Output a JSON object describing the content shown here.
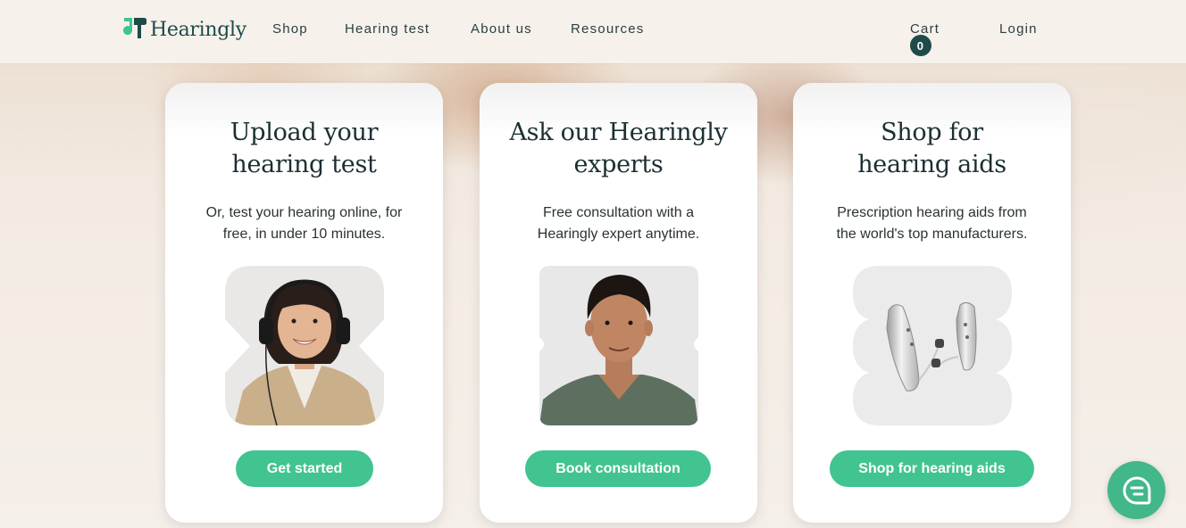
{
  "header": {
    "logo_text": "Hearingly",
    "nav": [
      "Shop",
      "Hearing test",
      "About us",
      "Resources"
    ],
    "cart_label": "Cart",
    "cart_count": "0",
    "login_label": "Login"
  },
  "cards": [
    {
      "title_line1": "Upload your",
      "title_line2": "hearing test",
      "desc_line1": "Or, test your hearing online, for",
      "desc_line2": "free, in under 10 minutes.",
      "button": "Get started",
      "image": "woman-with-headphones"
    },
    {
      "title_line1": "Ask our Hearingly",
      "title_line2": "experts",
      "desc_line1": "Free consultation with a",
      "desc_line2": "Hearingly expert anytime.",
      "button": "Book consultation",
      "image": "expert-portrait"
    },
    {
      "title_line1": "Shop for",
      "title_line2": "hearing aids",
      "desc_line1": "Prescription hearing aids from",
      "desc_line2": "the world's top manufacturers.",
      "button": "Shop for hearing aids",
      "image": "hearing-aids"
    }
  ],
  "colors": {
    "accent": "#41c48f",
    "brand_dark": "#1f4a4a",
    "page_bg": "#f3ebe3"
  },
  "chat": {
    "icon": "chat-icon"
  }
}
